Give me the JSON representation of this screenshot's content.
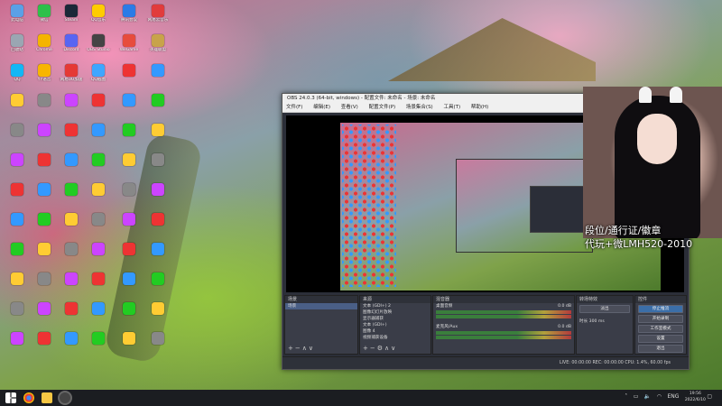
{
  "colors": {
    "obs_bg": "#2b2e38",
    "accent": "#3b6ea8",
    "taskbar": "#1b1d21"
  },
  "desktop_icons": [
    {
      "label": "此电脑",
      "color": "#5aa0e6",
      "icon": "computer-icon"
    },
    {
      "label": "微信",
      "color": "#2ec04a",
      "icon": "wechat-icon"
    },
    {
      "label": "Steam",
      "color": "#1b2838",
      "icon": "steam-icon"
    },
    {
      "label": "QQ音乐",
      "color": "#ffcc00",
      "icon": "music-icon"
    },
    {
      "label": "腾讯会议",
      "color": "#2b7be6",
      "icon": "meeting-icon"
    },
    {
      "label": "网易云音乐",
      "color": "#e13c3c",
      "icon": "music-icon"
    },
    {
      "label": "回收站",
      "color": "#9aa6b2",
      "icon": "recycle-bin-icon"
    },
    {
      "label": "Chrome",
      "color": "#f4b400",
      "icon": "chrome-icon"
    },
    {
      "label": "Discord",
      "color": "#5865f2",
      "icon": "discord-icon"
    },
    {
      "label": "OBS Studio",
      "color": "#444444",
      "icon": "obs-icon"
    },
    {
      "label": "WeGame",
      "color": "#e74c3c",
      "icon": "game-icon"
    },
    {
      "label": "英雄联盟",
      "color": "#c8a34a",
      "icon": "game-icon"
    },
    {
      "label": "QQ",
      "color": "#12b7f5",
      "icon": "qq-icon"
    },
    {
      "label": "YY语音",
      "color": "#f7b500",
      "icon": "voice-icon"
    },
    {
      "label": "网易UU加速",
      "color": "#e53935",
      "icon": "accelerator-icon"
    },
    {
      "label": "QQ截图",
      "color": "#3ea6ff",
      "icon": "screenshot-icon"
    }
  ],
  "obs": {
    "title": "OBS 24.0.3 (64-bit, windows) - 配置文件: 未命名 - 场景: 未命名",
    "menu": [
      "文件(F)",
      "编辑(E)",
      "查看(V)",
      "配置文件(P)",
      "场景集合(S)",
      "工具(T)",
      "帮助(H)"
    ],
    "docks": {
      "scenes": {
        "title": "场景",
        "items": [
          "场景"
        ]
      },
      "sources": {
        "title": "来源",
        "items": [
          "文本 (GDI+) 2",
          "图像幻灯片放映",
          "显示器捕获",
          "文本 (GDI+)",
          "图像 4",
          "视频捕获设备"
        ]
      },
      "mixer": {
        "title": "混音器",
        "channels": [
          {
            "name": "桌面音频",
            "db": "0.0 dB"
          },
          {
            "name": "麦克风/Aux",
            "db": "0.0 dB"
          }
        ]
      },
      "transitions": {
        "title": "转场特效",
        "type": "淡出",
        "duration_label": "时长",
        "duration": "300 ms"
      },
      "controls": {
        "title": "控件",
        "buttons": [
          "停止推流",
          "开始录制",
          "工作室模式",
          "设置",
          "退出"
        ]
      }
    },
    "status": "LIVE: 00:00:00   REC: 00:00:00   CPU: 1.4%, 60.00 fps"
  },
  "overlay": {
    "line1": "段位/通行证/徽章",
    "line2": "代玩+微LMH520-2010"
  },
  "taskbar": {
    "time": "19:56",
    "date": "2022/6/10",
    "lang": "ENG"
  }
}
